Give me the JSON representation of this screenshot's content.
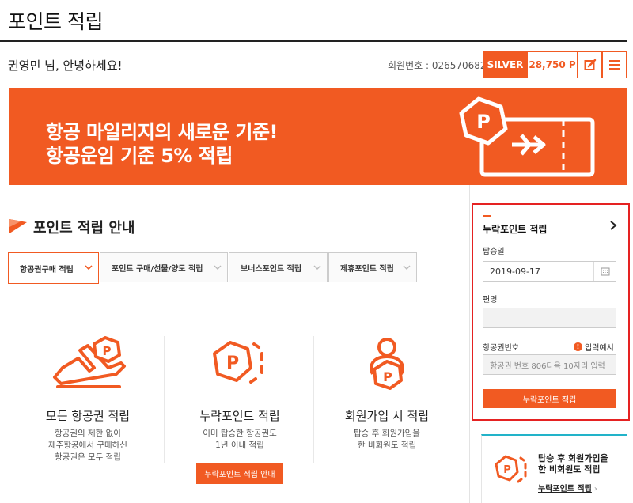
{
  "header": {
    "title": "포인트 적립",
    "greeting": "권영민 님, 안녕하세요!",
    "member_no": "회원번호 : 026570682",
    "grade": "SILVER",
    "points": "28,750 P"
  },
  "banner": {
    "line1": "항공 마일리지의 새로운 기준!",
    "line2": "항공운임 기준 5% 적립"
  },
  "section": {
    "title": "포인트 적립 안내"
  },
  "tabs": [
    {
      "label": "항공권구매 적립"
    },
    {
      "label": "포인트 구매/선물/양도 적립"
    },
    {
      "label": "보너스포인트 적립"
    },
    {
      "label": "제휴포인트 적립"
    }
  ],
  "columns": [
    {
      "title": "모든 항공권 적립",
      "desc": "항공권의 제한 없이\n제주항공에서 구매하신\n항공권은 모두 적립",
      "icon": "plane-point-icon"
    },
    {
      "title": "누락포인트 적립",
      "desc": "이미 탑승한 항공권도\n1년 이내 적립",
      "button": "누락포인트 적립 안내",
      "icon": "missing-point-icon"
    },
    {
      "title": "회원가입 시 적립",
      "desc": "탑승 후 회원가입을\n한 비회원도 적립",
      "icon": "member-point-icon"
    }
  ],
  "claim_form": {
    "title": "누락포인트 적립",
    "date_label": "탑승일",
    "date_value": "2019-09-17",
    "flight_label": "편명",
    "ticket_label": "항공권번호",
    "example_label": "입력예시",
    "ticket_placeholder": "항공권 번호 806다음 10자리 입력",
    "submit_label": "누락포인트 적립"
  },
  "promo": {
    "text": "탑승 후 회원가입을\n한 비회원도 적립",
    "link": "누락포인트 적립"
  },
  "colors": {
    "accent": "#f15a22",
    "highlight_border": "#e52222",
    "promo_top": "#22b3c9"
  }
}
